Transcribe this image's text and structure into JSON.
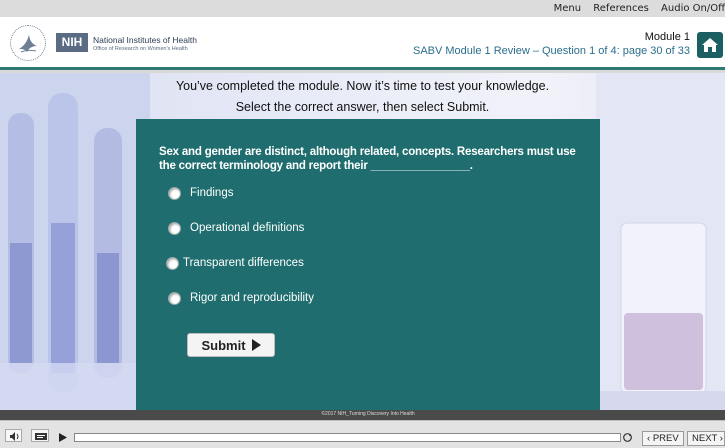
{
  "topbar": {
    "menu": "Menu",
    "references": "References",
    "audio": "Audio On/Off"
  },
  "header": {
    "nih_badge": "NIH",
    "nih_name": "National Institutes of Health",
    "nih_office": "Office of Research on Women's Health",
    "module_title": "Module 1",
    "module_subtitle": "SABV Module 1 Review – Question 1 of 4: page 30 of 33",
    "home_icon": "home-icon"
  },
  "stage": {
    "intro_line1": "You’ve completed the module. Now it’s time to test your knowledge.",
    "intro_line2": "Select the correct answer, then select Submit.",
    "question": "Sex and gender are distinct, although related, concepts. Researchers must use the correct terminology and report their ________________.",
    "options": [
      {
        "label": "Findings"
      },
      {
        "label": "Operational definitions"
      },
      {
        "label": "Transparent differences"
      },
      {
        "label": "Rigor and reproducibility"
      }
    ],
    "submit_label": "Submit"
  },
  "footer": {
    "copyright": "©2017 NIH_Turning Discovery Into Health"
  },
  "controls": {
    "prev_label": "PREV",
    "next_label": "NEXT"
  },
  "colors": {
    "panel": "#1f6d6e",
    "accent": "#2f7a73",
    "home_button": "#1b5f62"
  }
}
